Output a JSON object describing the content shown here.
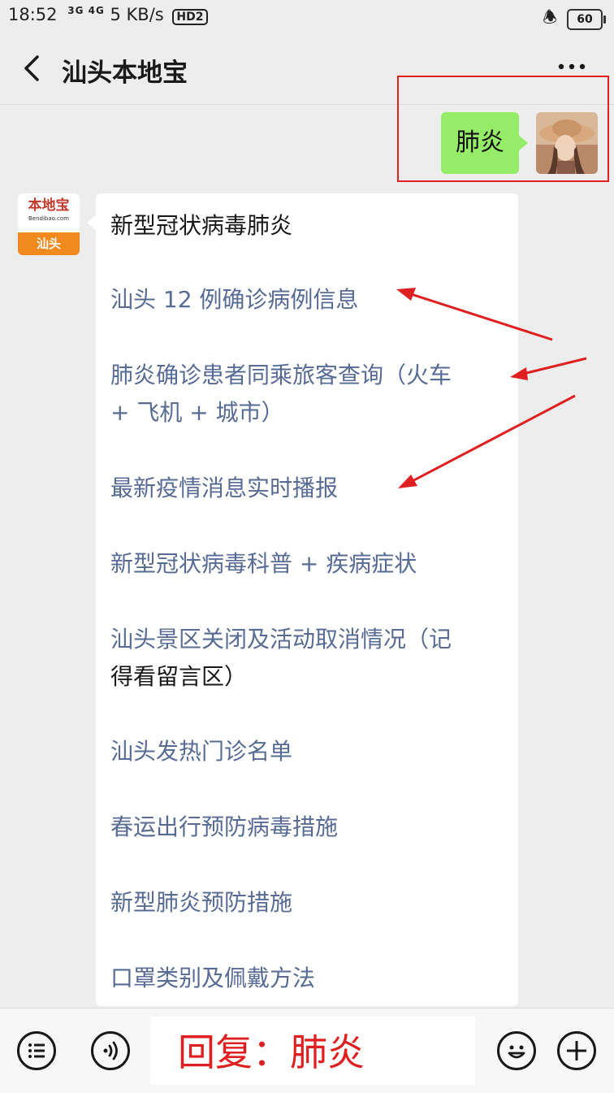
{
  "status_bar": {
    "time": "18:52",
    "network": "3G 4G",
    "speed": "5 KB/s",
    "hd_label": "HD2",
    "battery": "60"
  },
  "header": {
    "title": "汕头本地宝"
  },
  "outgoing_message": {
    "text": "肺炎"
  },
  "bot_avatar": {
    "logo_text": "本地宝",
    "site": "Bendibao.com",
    "city": "汕头"
  },
  "incoming_message": {
    "heading": "新型冠状病毒肺炎",
    "items": [
      {
        "line1": "汕头 12 例确诊病例信息",
        "line2": ""
      },
      {
        "line1": "肺炎确诊患者同乘旅客查询（火车",
        "line2": "+ 飞机 + 城市）"
      },
      {
        "line1": "最新疫情消息实时播报",
        "line2": ""
      },
      {
        "line1": "新型冠状病毒科普 + 疾病症状",
        "line2": ""
      },
      {
        "line1": "汕头景区关闭及活动取消情况（记",
        "line2": "得看留言区）"
      },
      {
        "line1": "汕头发热门诊名单",
        "line2": ""
      },
      {
        "line1": "春运出行预防病毒措施",
        "line2": ""
      },
      {
        "line1": "新型肺炎预防措施",
        "line2": ""
      },
      {
        "line1": "口罩类别及佩戴方法",
        "line2": ""
      }
    ]
  },
  "reply_hint": "回复：肺炎",
  "colors": {
    "link": "#576b95",
    "outgoing_bubble": "#95ec69",
    "annotation_red": "#e02020",
    "bot_avatar_orange": "#f08a1e"
  }
}
